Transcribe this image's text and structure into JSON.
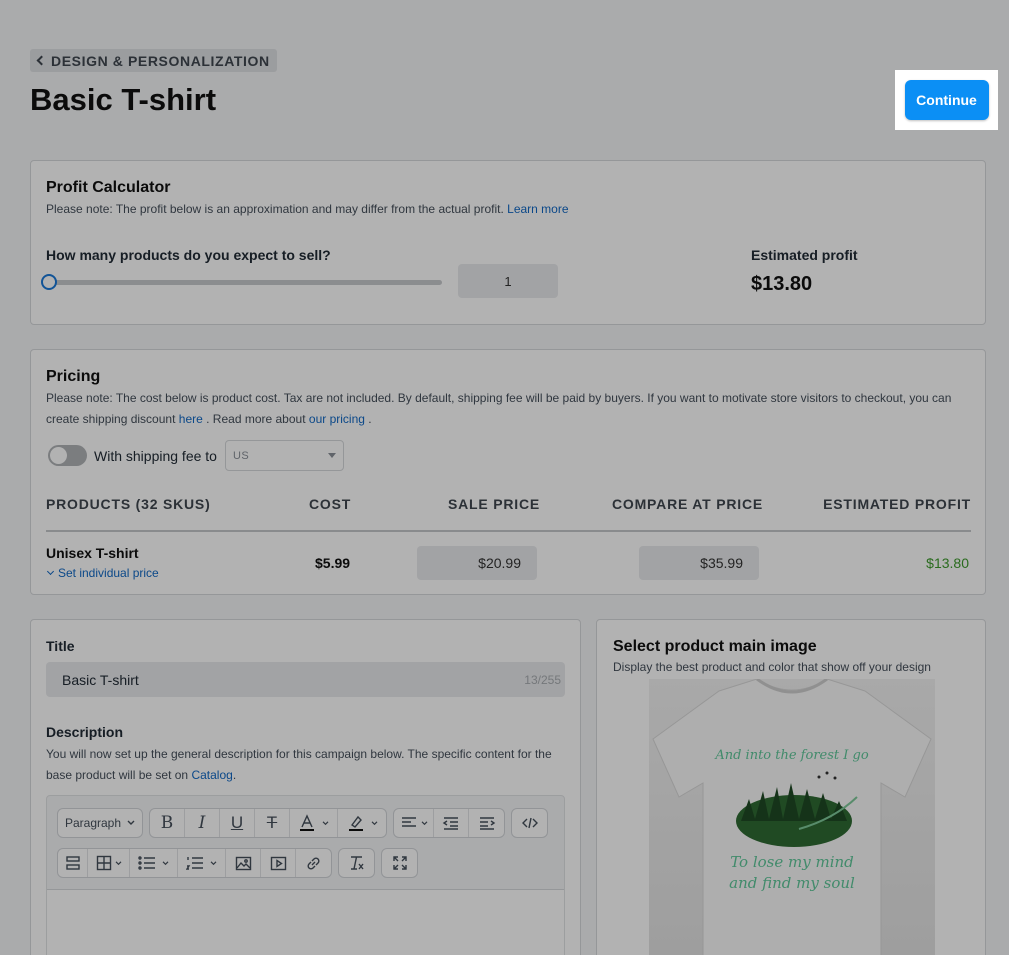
{
  "header": {
    "back_label": "DESIGN & PERSONALIZATION",
    "title": "Basic T-shirt",
    "continue_label": "Continue"
  },
  "profit_calculator": {
    "title": "Profit Calculator",
    "note": "Please note: The profit below is an approximation and may differ from the actual profit.",
    "learn_more": "Learn more",
    "question": "How many products do you expect to sell?",
    "quantity": "1",
    "slider_value": 1,
    "estimated_label": "Estimated profit",
    "estimated_value": "$13.80"
  },
  "pricing": {
    "title": "Pricing",
    "note_part1": "Please note: The cost below is product cost. Tax are not included. By default, shipping fee will be paid by buyers. If you want to motivate store visitors to checkout, you can create shipping discount",
    "here_link": "here",
    "note_part2": ". Read more about",
    "pricing_link": "our pricing",
    "note_part3": ".",
    "shipping_toggle_label": "With shipping fee to",
    "shipping_toggle_on": false,
    "country": "US",
    "columns": [
      "PRODUCTS (32 SKUS)",
      "COST",
      "SALE PRICE",
      "COMPARE AT PRICE",
      "ESTIMATED PROFIT"
    ],
    "row": {
      "name": "Unisex T-shirt",
      "set_price_link": "Set individual price",
      "cost": "$5.99",
      "sale_price": "$20.99",
      "compare_price": "$35.99",
      "profit": "$13.80"
    }
  },
  "details": {
    "title_label": "Title",
    "title_value": "Basic T-shirt",
    "title_count": "13/255",
    "description_label": "Description",
    "description_note": "You will now set up the general description for this campaign below. The specific content for the base product will be set on",
    "catalog_link": "Catalog",
    "description_note_end": ".",
    "paragraph_select": "Paragraph"
  },
  "main_image": {
    "title": "Select product main image",
    "note": "Display the best product and color that show off your design",
    "shirt_text_top": "And into the forest I go",
    "shirt_text_bottom1": "To lose my mind",
    "shirt_text_bottom2": "and find my soul"
  },
  "colors": {
    "accent": "#0b8ff5",
    "link": "#1168c4",
    "profit_green": "#3d9a2c"
  }
}
